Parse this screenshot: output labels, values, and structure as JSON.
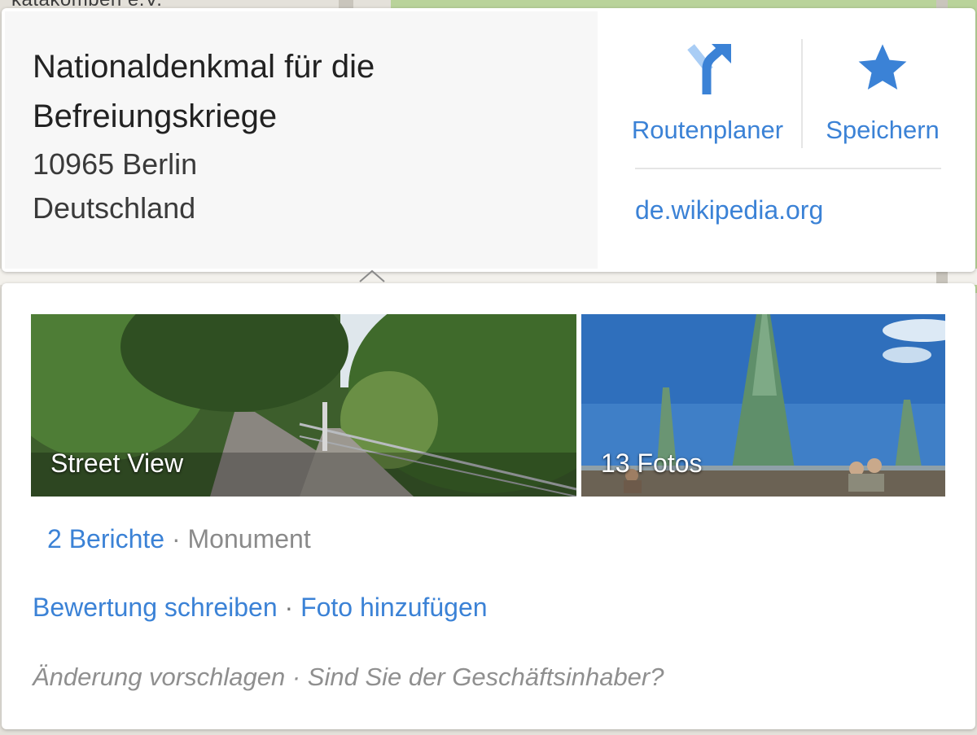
{
  "map": {
    "partial_label": "katakomben e.V."
  },
  "place": {
    "title": "Nationaldenkmal für die Befreiungskriege",
    "address_line1": "10965 Berlin",
    "address_line2": "Deutschland"
  },
  "actions": {
    "route_label": "Routenplaner",
    "save_label": "Speichern",
    "website": "de.wikipedia.org"
  },
  "photos": {
    "street_view_label": "Street View",
    "photos_label": "13 Fotos"
  },
  "meta": {
    "reviews": "2 Berichte",
    "separator": " · ",
    "category": "Monument"
  },
  "links": {
    "write_review": "Bewertung schreiben",
    "separator": " · ",
    "add_photo": "Foto hinzufügen"
  },
  "suggest": {
    "suggest_edit": "Änderung vorschlagen",
    "separator": " · ",
    "owner_question": "Sind Sie der Geschäftsinhaber?"
  },
  "colors": {
    "accent": "#3b82d6",
    "muted": "#8a8a8a"
  },
  "icons": {
    "route": "directions-arrow-icon",
    "save": "star-icon"
  }
}
